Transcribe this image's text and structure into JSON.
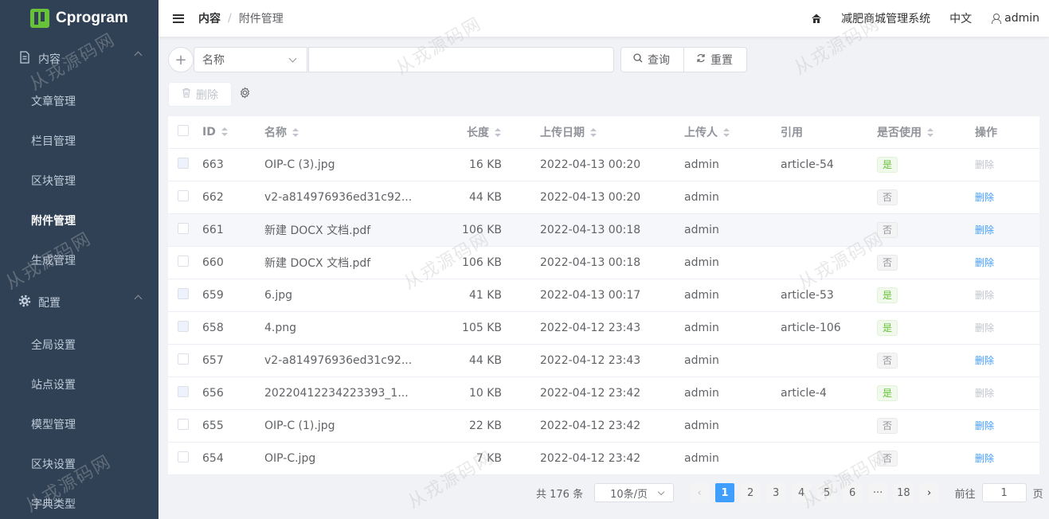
{
  "app": {
    "logo_text": "Cprogram"
  },
  "sidebar": {
    "groups": [
      {
        "label": "内容",
        "items": [
          "文章管理",
          "栏目管理",
          "区块管理",
          "附件管理",
          "生成管理"
        ]
      },
      {
        "label": "配置",
        "items": [
          "全局设置",
          "站点设置",
          "模型管理",
          "区块设置",
          "字典类型"
        ]
      }
    ],
    "active_item": "附件管理"
  },
  "header": {
    "breadcrumb": [
      "内容",
      "附件管理"
    ],
    "site_name": "减肥商城管理系统",
    "language": "中文",
    "user": "admin"
  },
  "toolbar": {
    "field_select": "名称",
    "search_value": "",
    "search_label": "查询",
    "reset_label": "重置",
    "delete_label": "删除"
  },
  "table": {
    "columns": [
      "ID",
      "名称",
      "长度",
      "上传日期",
      "上传人",
      "引用",
      "是否使用",
      "操作"
    ],
    "rows": [
      {
        "id": "663",
        "name": "OIP-C (3).jpg",
        "size": "16 KB",
        "date": "2022-04-13 00:20",
        "user": "admin",
        "ref": "article-54",
        "used": "是",
        "op": "删除"
      },
      {
        "id": "662",
        "name": "v2-a814976936ed31c92...",
        "size": "44 KB",
        "date": "2022-04-13 00:20",
        "user": "admin",
        "ref": "",
        "used": "否",
        "op": "删除"
      },
      {
        "id": "661",
        "name": "新建 DOCX 文档.pdf",
        "size": "106 KB",
        "date": "2022-04-13 00:18",
        "user": "admin",
        "ref": "",
        "used": "否",
        "op": "删除"
      },
      {
        "id": "660",
        "name": "新建 DOCX 文档.pdf",
        "size": "106 KB",
        "date": "2022-04-13 00:18",
        "user": "admin",
        "ref": "",
        "used": "否",
        "op": "删除"
      },
      {
        "id": "659",
        "name": "6.jpg",
        "size": "41 KB",
        "date": "2022-04-13 00:17",
        "user": "admin",
        "ref": "article-53",
        "used": "是",
        "op": "删除"
      },
      {
        "id": "658",
        "name": "4.png",
        "size": "105 KB",
        "date": "2022-04-12 23:43",
        "user": "admin",
        "ref": "article-106",
        "used": "是",
        "op": "删除"
      },
      {
        "id": "657",
        "name": "v2-a814976936ed31c92...",
        "size": "44 KB",
        "date": "2022-04-12 23:43",
        "user": "admin",
        "ref": "",
        "used": "否",
        "op": "删除"
      },
      {
        "id": "656",
        "name": "20220412234223393_1...",
        "size": "10 KB",
        "date": "2022-04-12 23:42",
        "user": "admin",
        "ref": "article-4",
        "used": "是",
        "op": "删除"
      },
      {
        "id": "655",
        "name": "OIP-C (1).jpg",
        "size": "22 KB",
        "date": "2022-04-12 23:42",
        "user": "admin",
        "ref": "",
        "used": "否",
        "op": "删除"
      },
      {
        "id": "654",
        "name": "OIP-C.jpg",
        "size": "7 KB",
        "date": "2022-04-12 23:42",
        "user": "admin",
        "ref": "",
        "used": "否",
        "op": "删除"
      }
    ]
  },
  "pagination": {
    "total_text": "共 176 条",
    "page_size": "10条/页",
    "pages": [
      "1",
      "2",
      "3",
      "4",
      "5",
      "6",
      "···",
      "18"
    ],
    "current": "1",
    "goto_label": "前往",
    "goto_value": "1",
    "page_unit": "页"
  },
  "watermark": "从戎源码网",
  "colors": {
    "sidebar_bg": "#304156",
    "primary": "#409eff",
    "success": "#67c23a"
  }
}
